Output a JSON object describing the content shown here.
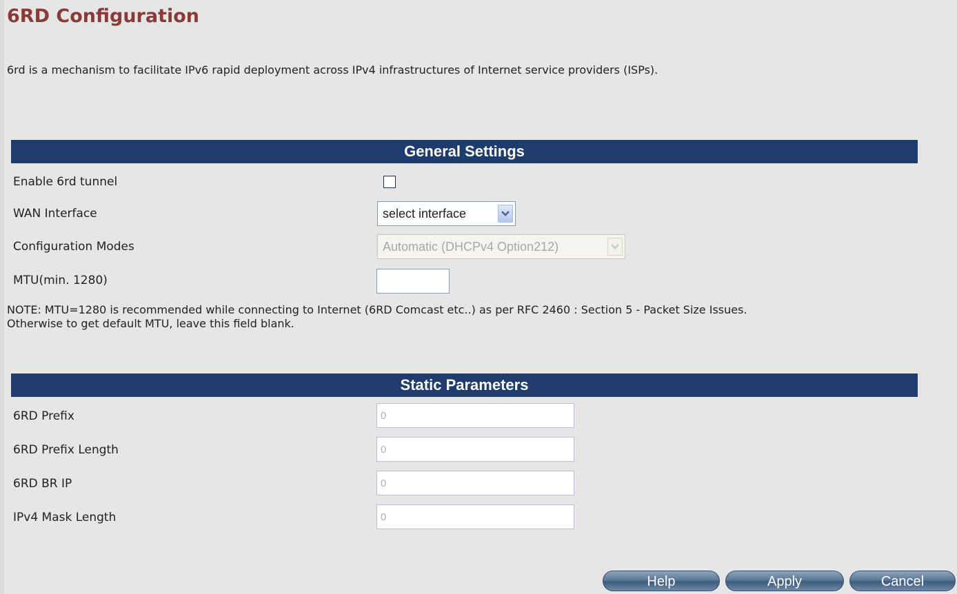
{
  "page": {
    "title": "6RD Configuration",
    "description": "6rd is a mechanism to facilitate IPv6 rapid deployment across IPv4 infrastructures of Internet service providers (ISPs)."
  },
  "general_settings": {
    "header": "General Settings",
    "enable_label": "Enable 6rd tunnel",
    "enable_checked": false,
    "wan_label": "WAN Interface",
    "wan_value": "select interface",
    "mode_label": "Configuration Modes",
    "mode_value": "Automatic (DHCPv4 Option212)",
    "mtu_label": "MTU(min. 1280)",
    "mtu_value": "",
    "note_line1": "NOTE: MTU=1280 is recommended while connecting to Internet (6RD Comcast etc..) as per RFC 2460 : Section 5 - Packet Size Issues.",
    "note_line2": "Otherwise to get default MTU, leave this field blank."
  },
  "static_parameters": {
    "header": "Static Parameters",
    "prefix_label": "6RD Prefix",
    "prefix_value": "0",
    "prefix_length_label": "6RD Prefix Length",
    "prefix_length_value": "0",
    "br_ip_label": "6RD BR IP",
    "br_ip_value": "0",
    "mask_length_label": "IPv4 Mask Length",
    "mask_length_value": "0"
  },
  "buttons": {
    "help": "Help",
    "apply": "Apply",
    "cancel": "Cancel"
  },
  "icons": {
    "dropdown": "chevron-down-icon"
  },
  "colors": {
    "title": "#8b3a36",
    "section_header_bg": "#1f3c6e",
    "button_bg": "#5b7898"
  }
}
